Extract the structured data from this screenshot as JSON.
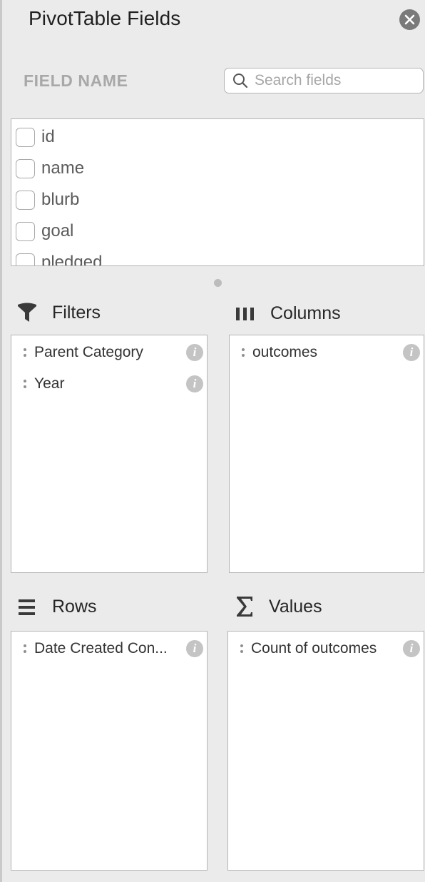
{
  "panel": {
    "title": "PivotTable Fields",
    "close_icon": "close-circle-icon"
  },
  "field_section": {
    "label": "FIELD NAME",
    "search_placeholder": "Search fields",
    "fields": [
      {
        "label": "id",
        "checked": false
      },
      {
        "label": "name",
        "checked": false
      },
      {
        "label": "blurb",
        "checked": false
      },
      {
        "label": "goal",
        "checked": false
      },
      {
        "label": "pledged",
        "checked": false
      }
    ]
  },
  "areas": {
    "filters": {
      "label": "Filters",
      "icon": "funnel-icon",
      "items": [
        {
          "label": "Parent Category"
        },
        {
          "label": "Year"
        }
      ]
    },
    "columns": {
      "label": "Columns",
      "icon": "columns-icon",
      "items": [
        {
          "label": "outcomes"
        }
      ]
    },
    "rows": {
      "label": "Rows",
      "icon": "rows-icon",
      "items": [
        {
          "label": "Date Created Con..."
        }
      ]
    },
    "values": {
      "label": "Values",
      "icon": "sigma-icon",
      "items": [
        {
          "label": "Count of outcomes"
        }
      ]
    }
  },
  "colors": {
    "panel_bg": "#ebebeb",
    "box_bg": "#ffffff",
    "border": "#b5b5b5",
    "info_icon": "#c4c4c4",
    "muted_text": "#a8a8a8"
  }
}
